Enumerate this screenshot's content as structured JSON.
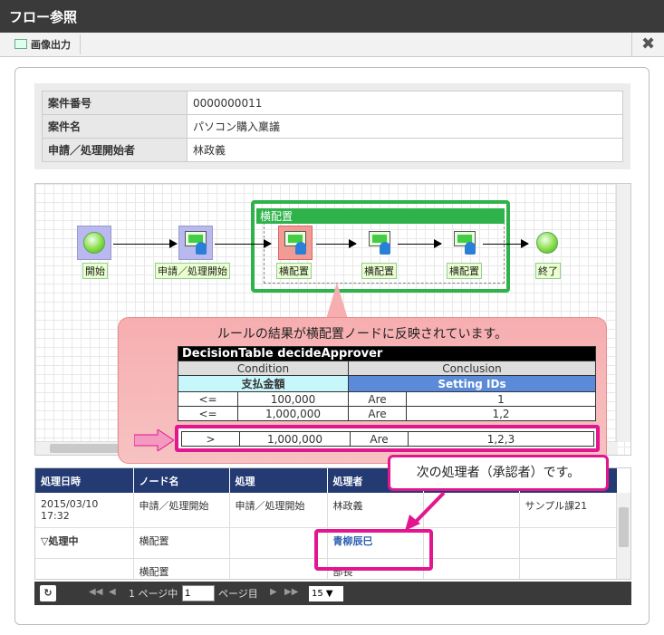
{
  "window": {
    "title": "フロー参照",
    "close_icon": "close-icon"
  },
  "toolbar": {
    "image_output_label": "画像出力"
  },
  "info": {
    "rows": [
      {
        "key": "案件番号",
        "value": "0000000011"
      },
      {
        "key": "案件名",
        "value": "パソコン購入稟議"
      },
      {
        "key": "申請／処理開始者",
        "value": "林政義"
      }
    ]
  },
  "flow": {
    "nodes": {
      "start": "開始",
      "apply": "申請／処理開始",
      "yoko1": "横配置",
      "yoko2": "横配置",
      "yoko3": "横配置",
      "end": "終了"
    },
    "group_title": "横配置"
  },
  "callout1": {
    "text": "ルールの結果が横配置ノードに反映されています。"
  },
  "decision_table": {
    "title": "DecisionTable decideApprover",
    "condition": "Condition",
    "conclusion": "Conclusion",
    "col1": "支払金額",
    "col2": "Setting IDs",
    "rows": [
      {
        "op": "<=",
        "amount": "100,000",
        "are": "Are",
        "ids": "1"
      },
      {
        "op": "<=",
        "amount": "1,000,000",
        "are": "Are",
        "ids": "1,2"
      }
    ],
    "highlight": {
      "op": ">",
      "amount": "1,000,000",
      "are": "Are",
      "ids": "1,2,3"
    }
  },
  "callout2": {
    "text": "次の処理者（承認者）です。"
  },
  "history": {
    "headers": [
      "処理日時",
      "ノード名",
      "処理",
      "処理者"
    ],
    "rows": [
      {
        "date": "2015/03/10",
        "time": "17:32",
        "node": "申請／処理開始",
        "action": "申請／処理開始",
        "user": "林政義",
        "dept": "サンプル課21"
      },
      {
        "date": "▽処理中",
        "time": "",
        "node": "横配置",
        "action": "",
        "user": "青柳辰巳",
        "dept": ""
      },
      {
        "date": "",
        "time": "",
        "node": "横配置",
        "action": "",
        "user": "部長",
        "dept": ""
      }
    ]
  },
  "pager": {
    "page_prefix": "1 ページ中",
    "page_value": "1",
    "page_suffix": "ページ目",
    "per_page": "15 ▼"
  }
}
